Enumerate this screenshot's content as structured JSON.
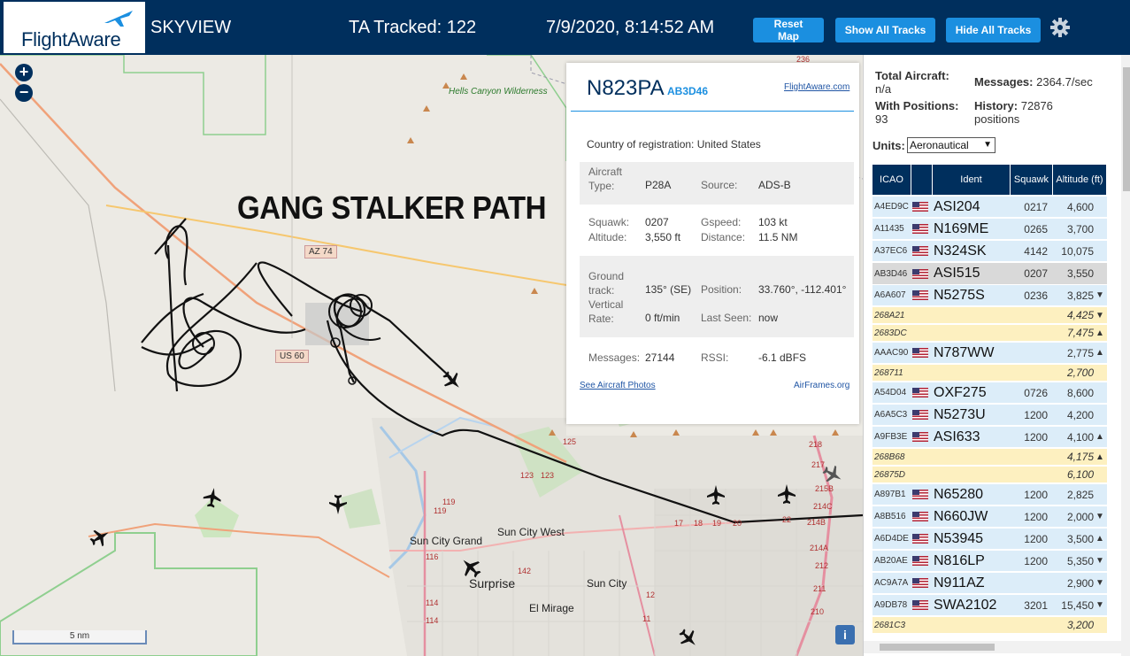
{
  "header": {
    "logo_text": "FlightAware",
    "app_title": "SKYVIEW",
    "tracked_label": "TA Tracked:",
    "tracked_count": "122",
    "datetime": "7/9/2020, 8:14:52 AM",
    "buttons": {
      "reset": "Reset Map",
      "show_all": "Show All Tracks",
      "hide_all": "Hide All Tracks"
    }
  },
  "map": {
    "zoom_in": "+",
    "zoom_out": "−",
    "overlay_text": "GANG STALKER PATH",
    "labels": {
      "wilderness": "Hells Canyon Wilderness",
      "sun_city_grand": "Sun City Grand",
      "sun_city_west": "Sun City West",
      "surprise": "Surprise",
      "sun_city": "Sun City",
      "el_mirage": "El Mirage"
    },
    "shields": {
      "az74": "AZ 74",
      "us60": "US 60"
    },
    "road_numbers": [
      "236",
      "125",
      "123",
      "123",
      "119",
      "119",
      "116",
      "114",
      "114",
      "142",
      "17",
      "18",
      "19",
      "20",
      "22",
      "218",
      "217",
      "215B",
      "214C",
      "214B",
      "214A",
      "212",
      "211",
      "210",
      "11",
      "12"
    ],
    "scale": "5 nm",
    "info": "i"
  },
  "popup": {
    "registration": "N823PA",
    "hex": "AB3D46",
    "fa_link": "FlightAware.com",
    "country_label": "Country of registration:",
    "country": "United States",
    "aircraft_type_label": "Aircraft Type:",
    "aircraft_type": "P28A",
    "source_label": "Source:",
    "source": "ADS-B",
    "squawk_label": "Squawk:",
    "squawk": "0207",
    "gspeed_label": "Gspeed:",
    "gspeed": "103 kt",
    "altitude_label": "Altitude:",
    "altitude": "3,550 ft",
    "distance_label": "Distance:",
    "distance": "11.5 NM",
    "ground_track_label": "Ground track:",
    "ground_track": "135° (SE)",
    "position_label": "Position:",
    "position": "33.760°, -112.401°",
    "vertical_rate_label": "Vertical Rate:",
    "vertical_rate": "0 ft/min",
    "last_seen_label": "Last Seen:",
    "last_seen": "now",
    "messages_label": "Messages:",
    "messages": "27144",
    "rssi_label": "RSSI:",
    "rssi": "-6.1 dBFS",
    "photos_link": "See Aircraft Photos",
    "airframes_link": "AirFrames.org"
  },
  "stats": {
    "total_aircraft_label": "Total Aircraft:",
    "total_aircraft": "n/a",
    "messages_label": "Messages:",
    "messages": "2364.7/sec",
    "with_positions_label": "With Positions:",
    "with_positions": "93",
    "history_label": "History:",
    "history_count": "72876",
    "history_unit": "positions"
  },
  "units": {
    "label": "Units:",
    "selected": "Aeronautical"
  },
  "table": {
    "headers": {
      "icao": "ICAO",
      "ident": "Ident",
      "squawk": "Squawk",
      "altitude": "Altitude (ft)"
    },
    "rows": [
      {
        "icao": "A4ED9C",
        "ident": "ASI204",
        "squawk": "0217",
        "alt": "4,600",
        "trend": "",
        "type": "norm"
      },
      {
        "icao": "A11435",
        "ident": "N169ME",
        "squawk": "0265",
        "alt": "3,700",
        "trend": "",
        "type": "norm"
      },
      {
        "icao": "A37EC6",
        "ident": "N324SK",
        "squawk": "4142",
        "alt": "10,075",
        "trend": "",
        "type": "norm"
      },
      {
        "icao": "AB3D46",
        "ident": "ASI515",
        "squawk": "0207",
        "alt": "3,550",
        "trend": "",
        "type": "sel"
      },
      {
        "icao": "A6A607",
        "ident": "N5275S",
        "squawk": "0236",
        "alt": "3,825",
        "trend": "▼",
        "type": "norm"
      },
      {
        "icao": "268A21",
        "ident": "",
        "squawk": "",
        "alt": "4,425",
        "trend": "▼",
        "type": "nopos"
      },
      {
        "icao": "2683DC",
        "ident": "",
        "squawk": "",
        "alt": "7,475",
        "trend": "▲",
        "type": "nopos"
      },
      {
        "icao": "AAAC90",
        "ident": "N787WW",
        "squawk": "",
        "alt": "2,775",
        "trend": "▲",
        "type": "norm"
      },
      {
        "icao": "268711",
        "ident": "",
        "squawk": "",
        "alt": "2,700",
        "trend": "",
        "type": "nopos"
      },
      {
        "icao": "A54D04",
        "ident": "OXF275",
        "squawk": "0726",
        "alt": "8,600",
        "trend": "",
        "type": "norm"
      },
      {
        "icao": "A6A5C3",
        "ident": "N5273U",
        "squawk": "1200",
        "alt": "4,200",
        "trend": "",
        "type": "norm"
      },
      {
        "icao": "A9FB3E",
        "ident": "ASI633",
        "squawk": "1200",
        "alt": "4,100",
        "trend": "▲",
        "type": "norm"
      },
      {
        "icao": "268B68",
        "ident": "",
        "squawk": "",
        "alt": "4,175",
        "trend": "▲",
        "type": "nopos"
      },
      {
        "icao": "26875D",
        "ident": "",
        "squawk": "",
        "alt": "6,100",
        "trend": "",
        "type": "nopos"
      },
      {
        "icao": "A897B1",
        "ident": "N65280",
        "squawk": "1200",
        "alt": "2,825",
        "trend": "",
        "type": "norm"
      },
      {
        "icao": "A8B516",
        "ident": "N660JW",
        "squawk": "1200",
        "alt": "2,000",
        "trend": "▼",
        "type": "norm"
      },
      {
        "icao": "A6D4DE",
        "ident": "N53945",
        "squawk": "1200",
        "alt": "3,500",
        "trend": "▲",
        "type": "norm"
      },
      {
        "icao": "AB20AE",
        "ident": "N816LP",
        "squawk": "1200",
        "alt": "5,350",
        "trend": "▼",
        "type": "norm"
      },
      {
        "icao": "AC9A7A",
        "ident": "N911AZ",
        "squawk": "",
        "alt": "2,900",
        "trend": "▼",
        "type": "norm"
      },
      {
        "icao": "A9DB78",
        "ident": "SWA2102",
        "squawk": "3201",
        "alt": "15,450",
        "trend": "▼",
        "type": "norm"
      },
      {
        "icao": "2681C3",
        "ident": "",
        "squawk": "",
        "alt": "3,200",
        "trend": "",
        "type": "nopos"
      }
    ]
  },
  "colors": {
    "header_bg": "#002f5d",
    "button_bg": "#1b8fe0",
    "row_normal": "#dcedf9",
    "row_selected": "#d9d9d9",
    "row_no_position": "#fdf0c0",
    "track": "#111111"
  },
  "icons": [
    "flightaware-plane-icon",
    "gear-icon",
    "plane-icon",
    "us-flag-icon",
    "info-icon"
  ]
}
